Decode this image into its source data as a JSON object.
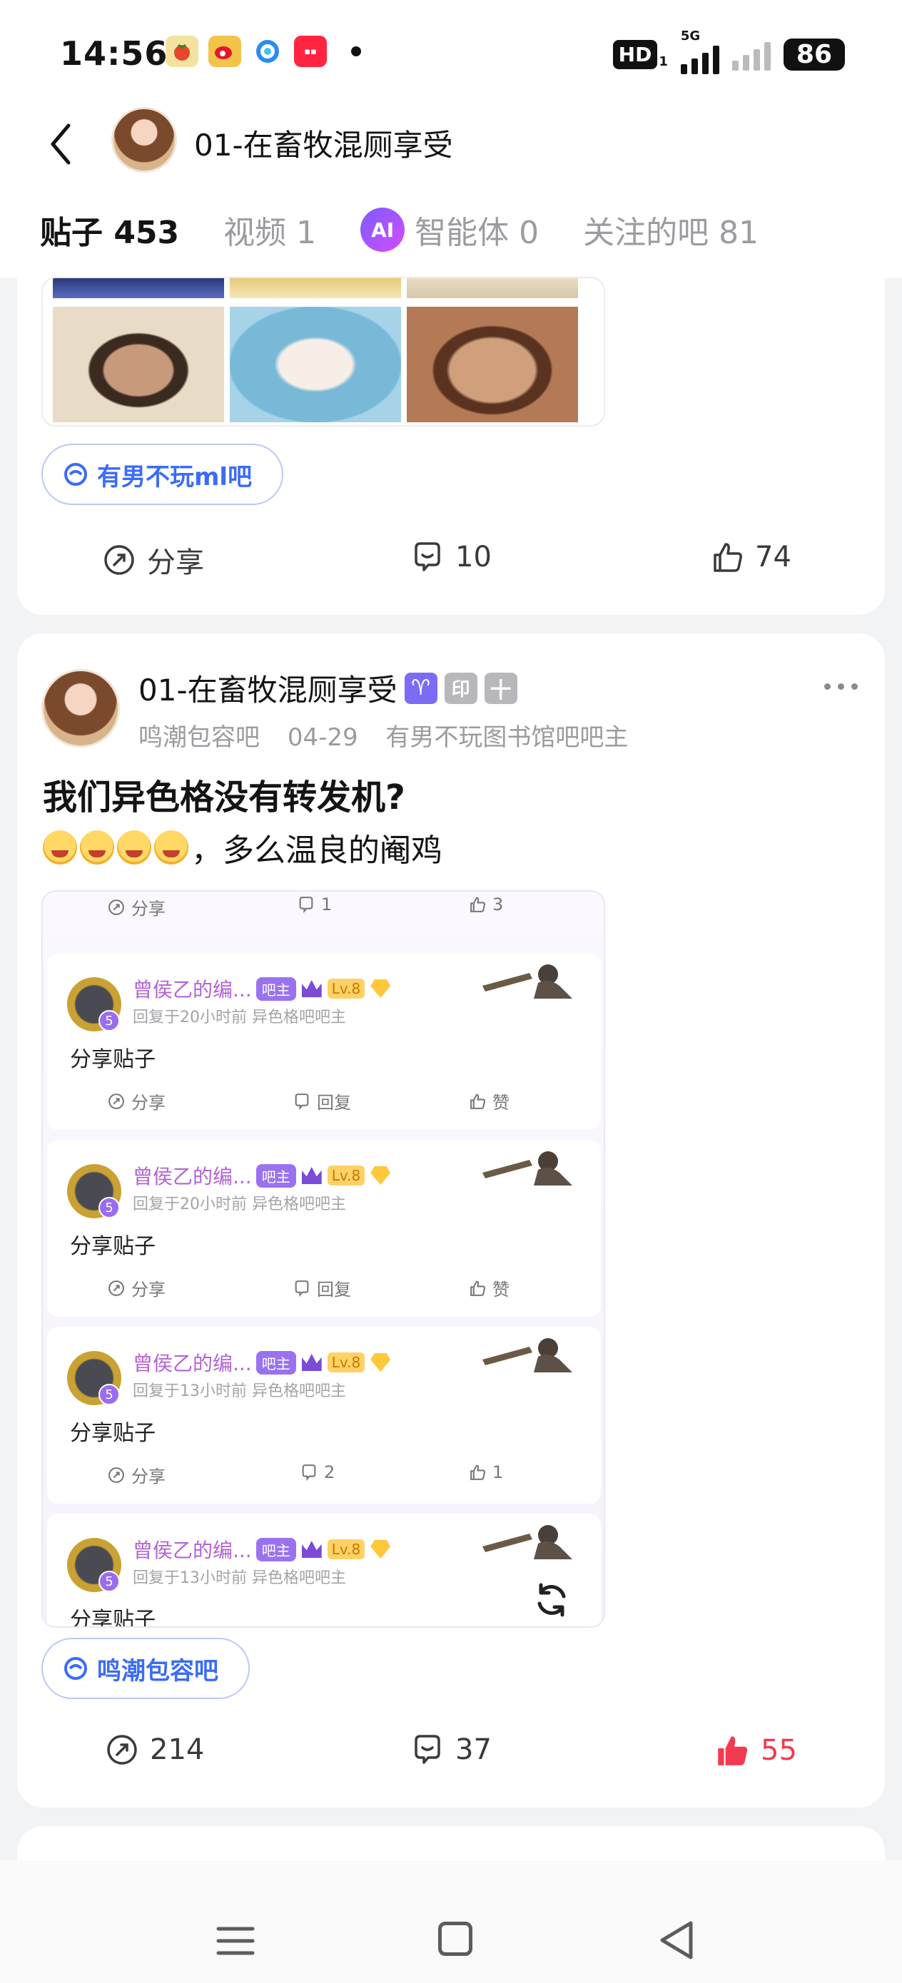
{
  "status_bar": {
    "time": "14:56",
    "hd": "HD",
    "hd_sub": "1",
    "network": "5G",
    "battery": "86"
  },
  "header": {
    "title": "01-在畜牧混厕享受",
    "tabs": [
      {
        "label": "贴子 453",
        "active": true
      },
      {
        "label": "视频 1",
        "active": false
      },
      {
        "label": "智能体 0",
        "active": false
      },
      {
        "label": "关注的吧 81",
        "active": false
      }
    ],
    "ai_icon_text": "AI"
  },
  "posts": [
    {
      "bar_tag": "有男不玩ml吧",
      "actions": {
        "share": "分享",
        "comments": "10",
        "likes": "74"
      }
    },
    {
      "author": "01-在畜牧混厕享受",
      "badges": [
        "♈",
        "印",
        "十"
      ],
      "meta": {
        "bar": "鸣潮包容吧",
        "date": "04-29",
        "role": "有男不玩图书馆吧吧主"
      },
      "title": "我们异色格没有转发机?",
      "body_text": "，多么温良的阉鸡",
      "emoji_count": 4,
      "shared_preview": {
        "top_row": {
          "share": "分享",
          "comments": "1",
          "likes": "3"
        },
        "replies": [
          {
            "name": "曾侯乙的编...",
            "tag": "吧主",
            "level": "Lv.8",
            "lv_badge": "5",
            "sub": "回复于20小时前   异色格吧吧主",
            "text": "分享贴子",
            "actions": {
              "share": "分享",
              "comments": "回复",
              "likes": "赞"
            }
          },
          {
            "name": "曾侯乙的编...",
            "tag": "吧主",
            "level": "Lv.8",
            "lv_badge": "5",
            "sub": "回复于20小时前   异色格吧吧主",
            "text": "分享贴子",
            "actions": {
              "share": "分享",
              "comments": "回复",
              "likes": "赞"
            }
          },
          {
            "name": "曾侯乙的编...",
            "tag": "吧主",
            "level": "Lv.8",
            "lv_badge": "5",
            "sub": "回复于13小时前   异色格吧吧主",
            "text": "分享贴子",
            "actions": {
              "share": "分享",
              "comments": "2",
              "likes": "1"
            }
          },
          {
            "name": "曾侯乙的编...",
            "tag": "吧主",
            "level": "Lv.8",
            "lv_badge": "5",
            "sub": "回复于13小时前   异色格吧吧主",
            "text": "分享贴子"
          }
        ]
      },
      "bar_tag": "鸣潮包容吧",
      "actions": {
        "shares": "214",
        "comments": "37",
        "likes": "55"
      }
    }
  ],
  "colors": {
    "accent": "#3b6cf5",
    "liked": "#f33a50",
    "muted": "#9b9ba0",
    "bar_master_purple": "#b463d6"
  }
}
